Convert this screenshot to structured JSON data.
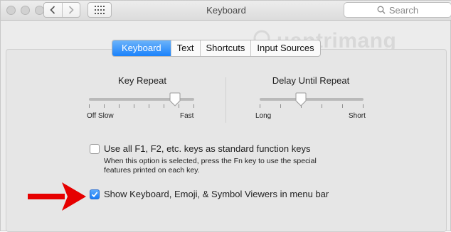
{
  "window": {
    "title": "Keyboard",
    "search_placeholder": "Search",
    "traffic_lights": [
      "close",
      "minimize",
      "zoom"
    ]
  },
  "tabs": [
    {
      "label": "Keyboard",
      "active": true
    },
    {
      "label": "Text",
      "active": false
    },
    {
      "label": "Shortcuts",
      "active": false
    },
    {
      "label": "Input Sources",
      "active": false
    }
  ],
  "key_repeat": {
    "title": "Key Repeat",
    "min_label": "Off Slow",
    "max_label": "Fast",
    "tick_count": 8,
    "value_fraction": 0.82
  },
  "delay_until_repeat": {
    "title": "Delay Until Repeat",
    "min_label": "Long",
    "max_label": "Short",
    "tick_count": 6,
    "value_fraction": 0.4
  },
  "options": {
    "fn_keys": {
      "label": "Use all F1, F2, etc. keys as standard function keys",
      "checked": false,
      "help": "When this option is selected, press the Fn key to use the special features printed on each key."
    },
    "viewers": {
      "label": "Show Keyboard, Emoji, & Symbol Viewers in menu bar",
      "checked": true
    }
  },
  "watermark": {
    "text": "uantrimang",
    "icon": "lightbulb-icon"
  },
  "annotation": {
    "icon": "red-arrow-icon",
    "color": "#e60000"
  },
  "colors": {
    "accent": "#1a82fb",
    "checkbox": "#1a7cf6"
  }
}
